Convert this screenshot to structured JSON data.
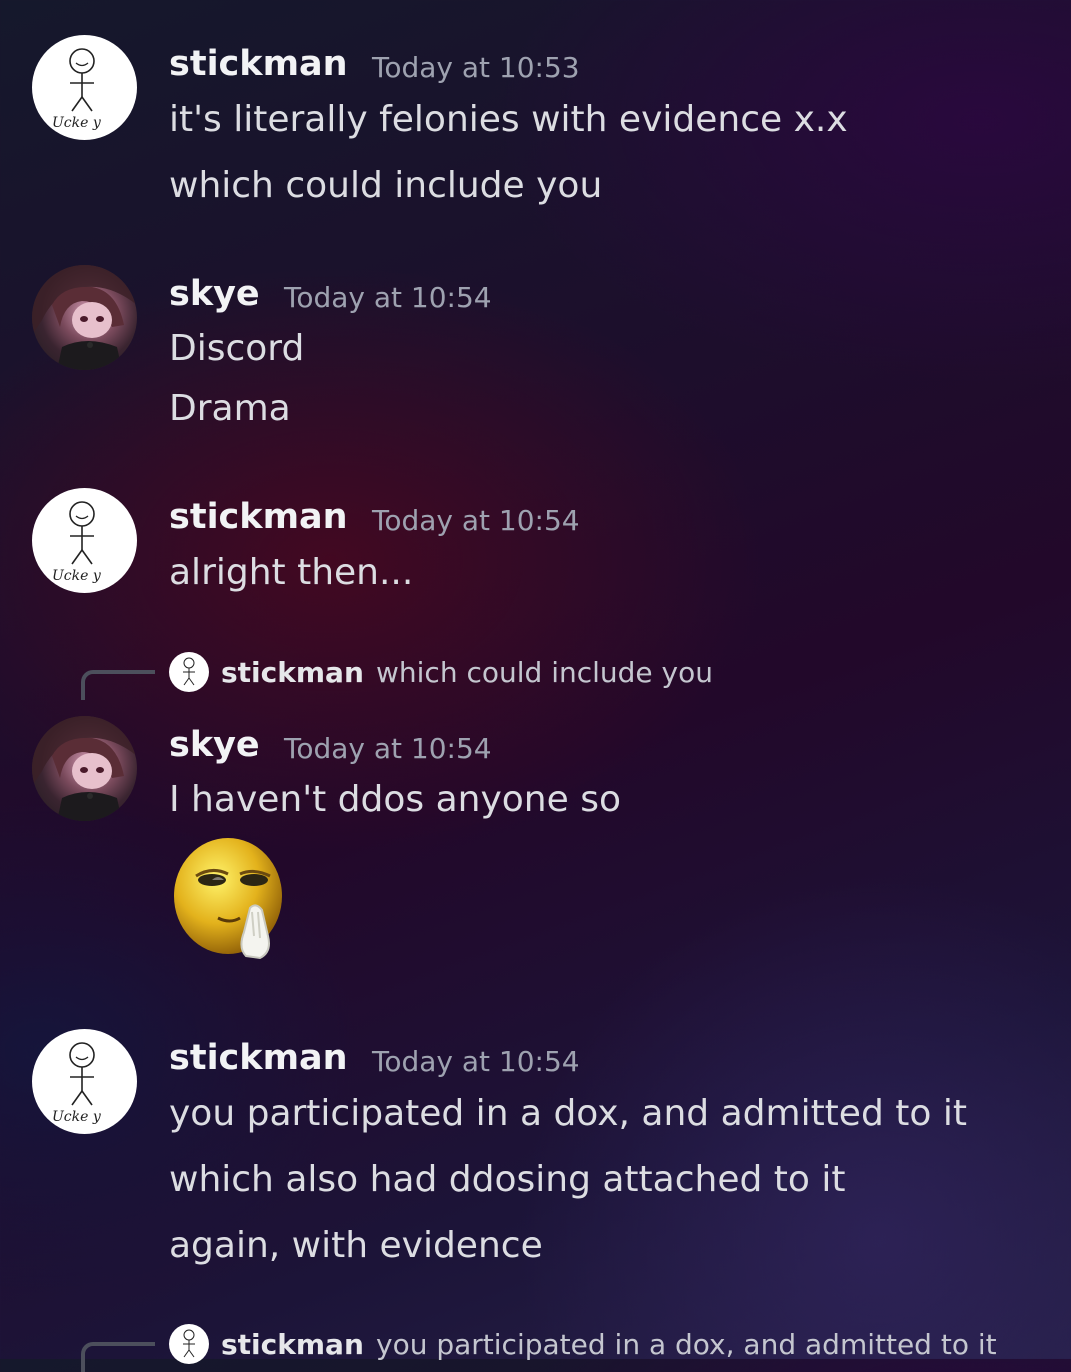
{
  "messages": [
    {
      "author": "stickman",
      "timestamp": "Today at 10:53",
      "lines": [
        "it's literally felonies with evidence x.x",
        "which could include you"
      ]
    },
    {
      "author": "skye",
      "timestamp": "Today at 10:54",
      "lines": [
        "Discord",
        "Drama"
      ]
    },
    {
      "author": "stickman",
      "timestamp": "Today at 10:54",
      "lines": [
        "alright then..."
      ]
    },
    {
      "reply": {
        "author": "stickman",
        "text": "which could include you"
      },
      "author": "skye",
      "timestamp": "Today at 10:54",
      "lines": [
        "I haven't ddos anyone so"
      ],
      "emoji": "thinking-smug-emoji"
    },
    {
      "author": "stickman",
      "timestamp": "Today at 10:54",
      "lines": [
        "you participated in a dox, and admitted to it",
        "which also had ddosing attached to it",
        "again, with evidence"
      ]
    },
    {
      "reply": {
        "author": "stickman",
        "text": "you participated in a dox, and admitted to it"
      }
    }
  ],
  "avatar_signature": "Ucke y",
  "colors": {
    "username": "#f2f3f5",
    "timestamp": "#9ea2b0",
    "message_text": "#dcdde2",
    "reply_line": "#4c4f5c"
  }
}
